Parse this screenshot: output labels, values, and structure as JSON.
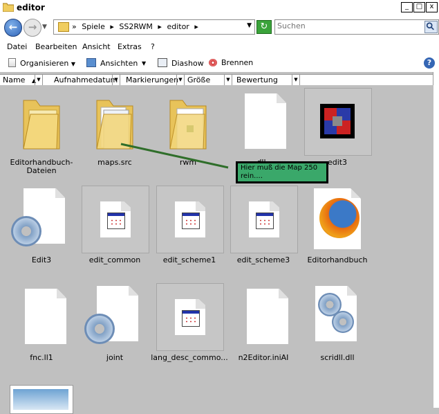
{
  "window": {
    "title": "editor",
    "buttons": [
      "_",
      "□",
      "x"
    ]
  },
  "address": {
    "crumbs": [
      "Spiele",
      "SS2RWM",
      "editor"
    ],
    "search_placeholder": "Suchen"
  },
  "menu": [
    "Datei",
    "Bearbeiten",
    "Ansicht",
    "Extras",
    "?"
  ],
  "toolbar": {
    "organize": "Organisieren",
    "views": "Ansichten",
    "slideshow": "Diashow",
    "burn": "Brennen"
  },
  "columns": [
    "Name",
    "Aufnahmedatum",
    "Markierungen",
    "Größe",
    "Bewertung"
  ],
  "files": [
    {
      "name": "Editorhandbuch-Dateien",
      "icon": "folder-icon"
    },
    {
      "name": "maps.src",
      "icon": "folder-icon"
    },
    {
      "name": "rwm",
      "icon": "folder-icon"
    },
    {
      "name": "dll",
      "icon": "blank-file-icon"
    },
    {
      "name": "edit3",
      "icon": "app-icon"
    },
    {
      "name": "Edit3",
      "icon": "config-file-icon"
    },
    {
      "name": "edit_common",
      "icon": "window-file-icon"
    },
    {
      "name": "edit_scheme1",
      "icon": "window-file-icon"
    },
    {
      "name": "edit_scheme3",
      "icon": "window-file-icon"
    },
    {
      "name": "Editorhandbuch",
      "icon": "firefox-icon"
    },
    {
      "name": "fnc.ll1",
      "icon": "blank-file-icon"
    },
    {
      "name": "joint",
      "icon": "config-file-icon"
    },
    {
      "name": "lang_desc_commo...",
      "icon": "window-file-icon"
    },
    {
      "name": "n2Editor.iniAI",
      "icon": "blank-file-icon"
    },
    {
      "name": "scridll.dll",
      "icon": "dll-file-icon"
    }
  ],
  "annotation": {
    "text": "Hier muß die Map 250 rein....",
    "color": "#3aa86a"
  }
}
